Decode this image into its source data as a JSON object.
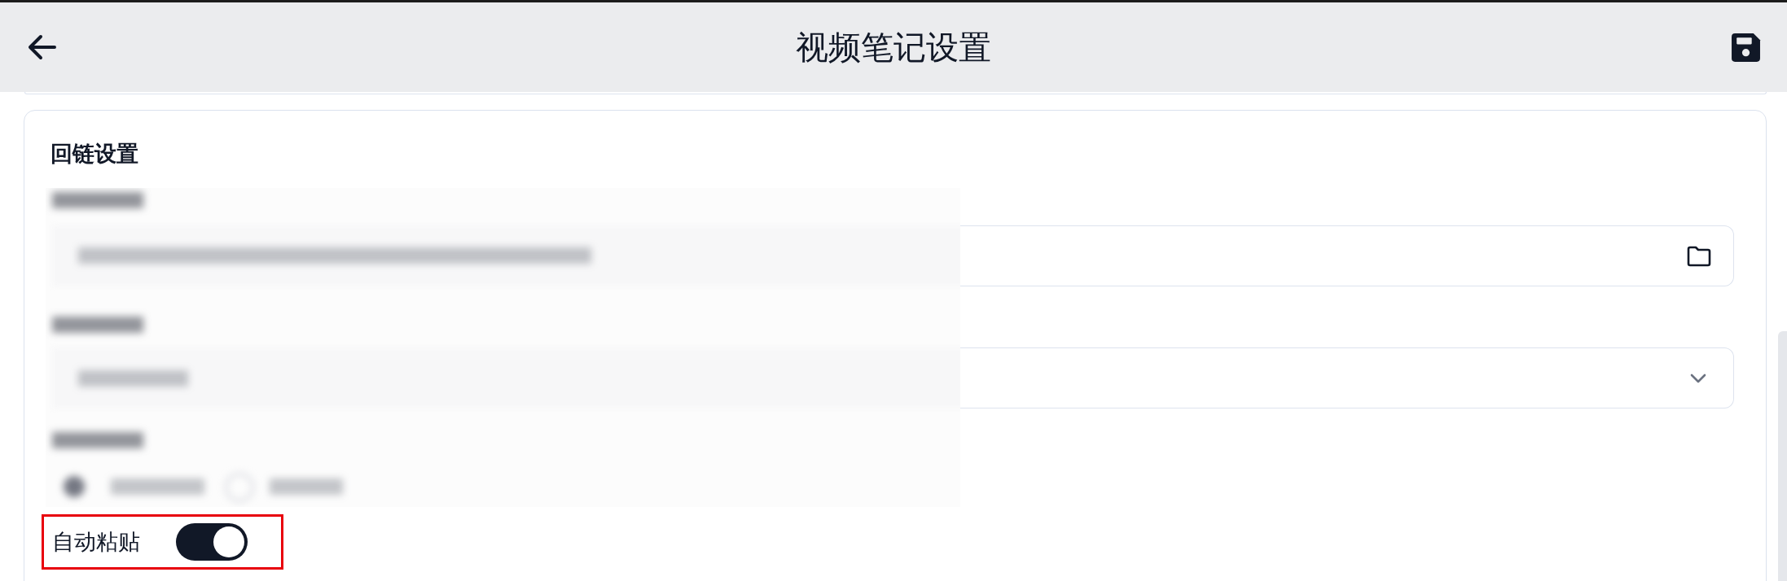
{
  "header": {
    "title": "视频笔记设置"
  },
  "section": {
    "title": "回链设置",
    "fields": [
      {
        "kind": "path"
      },
      {
        "kind": "select"
      }
    ],
    "auto_paste": {
      "label": "自动粘贴",
      "on": true,
      "highlighted": true
    }
  }
}
